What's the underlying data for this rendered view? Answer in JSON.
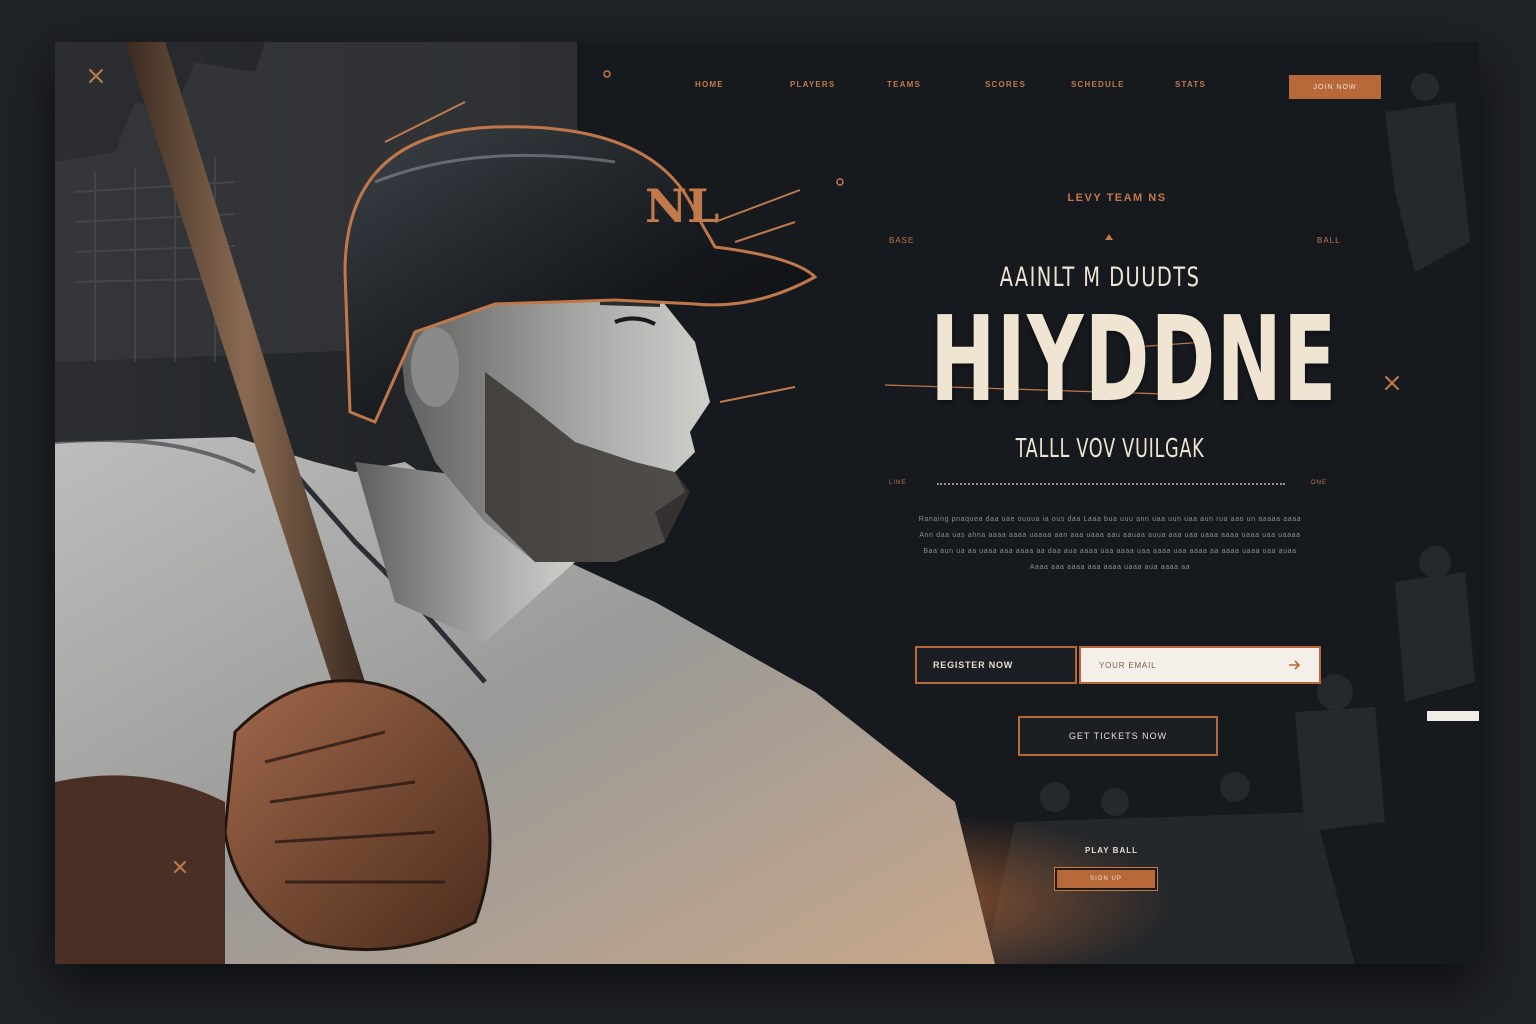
{
  "nav": {
    "items": [
      "HOME",
      "PLAYERS",
      "TEAMS",
      "SCORES",
      "SCHEDULE",
      "STATS"
    ],
    "cta": "JOIN NOW"
  },
  "hero": {
    "eyebrow": "LEVY TEAM NS",
    "side_left": "BASE",
    "side_right": "BALL",
    "subtitle": "AAINLT M DUUDTS",
    "headline": "HIYDDNE",
    "tagline": "TALLL VOV VUILGAK",
    "rule_left": "LINE",
    "rule_right": "ONE",
    "body": [
      "Ranaing pnaquea daa uae ouuua ia ous daa Laaa bua uuu ann uaa uun uaa aun rua aao un aaaaa aaaa",
      "Ann daa uas ahna aaaa aaaa uaaaa aan aaa uaaa aau aauaa auua aaa uaa uaaa aaaa uaaa uaa uaaaa",
      "Baa aun ua aa uaaa aaa aaaa aa daa aua aaaa uaa aaaa uaa aaaa uaa aaaa aa aaaa uaaa uaa auaa",
      "Aaaa aaa aaaa aaa aaaa uaaa aua aaaa aa"
    ]
  },
  "form": {
    "label": "REGISTER NOW",
    "placeholder": "YOUR EMAIL"
  },
  "secondary_button": "GET TICKETS NOW",
  "caption": "PLAY BALL",
  "small_button": "SIGN UP",
  "colors": {
    "accent": "#b8693a",
    "cream": "#f0e4d2",
    "background": "#16191e"
  }
}
